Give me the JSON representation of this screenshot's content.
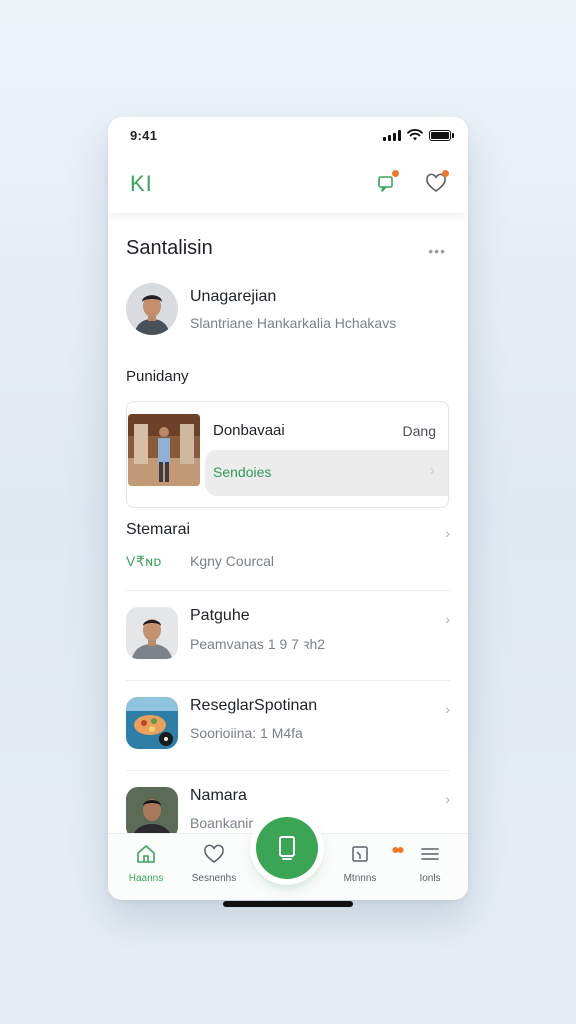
{
  "status_bar": {
    "time": "9:41"
  },
  "header": {
    "logo": "KI"
  },
  "section": {
    "title": "Santalisin",
    "more": "•••",
    "profile": {
      "name": "Unagarejian",
      "subtitle": "Slantriane Hankarkalia Hchakavs"
    }
  },
  "subsection": {
    "title": "Punidany"
  },
  "feature": {
    "title": "Donbavaai",
    "side_label": "Dang",
    "action_label": "Sendoies",
    "chevron": "›"
  },
  "list": [
    {
      "title": "Stemarai",
      "tag": "V₹ɴᴅ",
      "subtitle": "Kgny Courcal",
      "chevron": "›"
    },
    {
      "title": "Patguhe",
      "subtitle": "Peamvanas 1 9 7 ꝛh2",
      "chevron": "›"
    },
    {
      "title": "ReseglarSpotinan",
      "subtitle": "Soorioiina: 1 M4fa",
      "chevron": "›"
    },
    {
      "title": "Namara",
      "subtitle": "Boankanir",
      "chevron": "›"
    }
  ],
  "bottom_nav": [
    {
      "label": "Haanns",
      "icon": "home-icon",
      "active": true
    },
    {
      "label": "Sesnenhs",
      "icon": "heart-icon",
      "active": false
    },
    {
      "label": "Mtnnns",
      "icon": "calendar-icon",
      "active": false
    },
    {
      "label": "Ionls",
      "icon": "menu-icon",
      "active": false
    }
  ],
  "colors": {
    "accent": "#3aa655",
    "badge": "#f07a2a",
    "text": "#1e2226",
    "muted": "#7b8187"
  }
}
